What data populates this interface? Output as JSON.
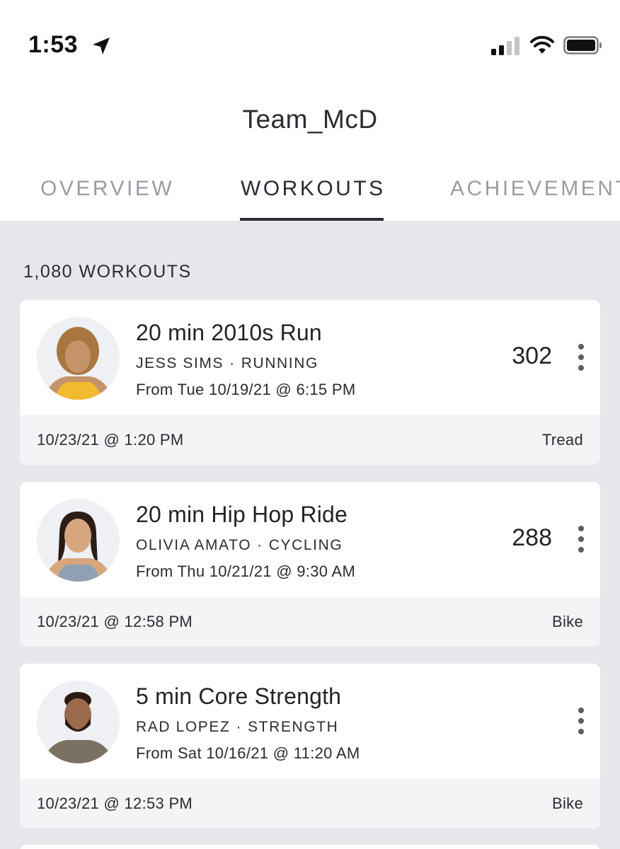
{
  "status_bar": {
    "time": "1:53",
    "icons": [
      "location-arrow-icon",
      "cellular-signal-icon",
      "wifi-icon",
      "battery-icon"
    ]
  },
  "header": {
    "title": "Team_McD"
  },
  "tabs": [
    {
      "label": "OVERVIEW",
      "active": false
    },
    {
      "label": "WORKOUTS",
      "active": true
    },
    {
      "label": "ACHIEVEMENTS",
      "active": false
    }
  ],
  "workouts": {
    "count_label": "1,080 WORKOUTS",
    "items": [
      {
        "title": "20 min 2010s Run",
        "instructor": "JESS SIMS",
        "separator": "·",
        "category": "RUNNING",
        "from": "From Tue 10/19/21 @ 6:15 PM",
        "output": "302",
        "date": "10/23/21 @ 1:20 PM",
        "device": "Tread"
      },
      {
        "title": "20 min Hip Hop Ride",
        "instructor": "OLIVIA AMATO",
        "separator": "·",
        "category": "CYCLING",
        "from": "From Thu 10/21/21 @ 9:30 AM",
        "output": "288",
        "date": "10/23/21 @ 12:58 PM",
        "device": "Bike"
      },
      {
        "title": "5 min Core Strength",
        "instructor": "RAD LOPEZ",
        "separator": "·",
        "category": "STRENGTH",
        "from": "From Sat 10/16/21 @ 11:20 AM",
        "output": "",
        "date": "10/23/21 @ 12:53 PM",
        "device": "Bike"
      }
    ]
  },
  "colors": {
    "background_gray": "#e6e7eb",
    "text_dark": "#222428",
    "tab_inactive": "#9a9ca1",
    "card_footer": "#f4f4f6"
  }
}
